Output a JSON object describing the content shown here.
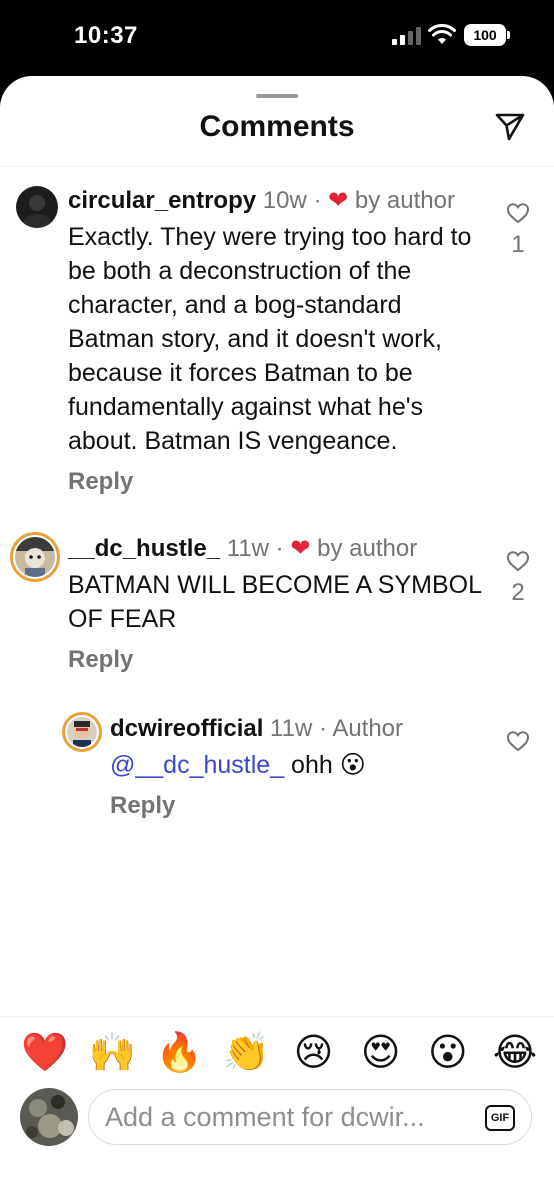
{
  "status_bar": {
    "time": "10:37",
    "battery": "100"
  },
  "header": {
    "title": "Comments",
    "send_icon": "send-icon"
  },
  "comments": [
    {
      "username": "circular_entropy",
      "time": "10w",
      "separator": "·",
      "heart": "❤",
      "liked_by": "by author",
      "text": "Exactly. They were trying too hard to be both a deconstruction of the character, and a bog-standard Batman story, and it doesn't work, because it forces Batman to be fundamentally against what he's about. Batman IS vengeance.",
      "reply_label": "Reply",
      "like_count": "1"
    },
    {
      "username": "__dc_hustle_",
      "time": "11w",
      "separator": "·",
      "heart": "❤",
      "liked_by": "by author",
      "text": "BATMAN WILL BECOME A SYMBOL OF FEAR",
      "reply_label": "Reply",
      "like_count": "2"
    }
  ],
  "reply": {
    "username": "dcwireofficial",
    "time": "11w",
    "separator": "·",
    "author_label": "Author",
    "mention": "@__dc_hustle_",
    "text": " ohh 😮",
    "reply_label": "Reply"
  },
  "reactions": [
    "❤️",
    "🙌",
    "🔥",
    "👏",
    "😢",
    "😍",
    "😮",
    "😂"
  ],
  "composer": {
    "placeholder": "Add a comment for dcwir...",
    "gif_label": "GIF"
  },
  "colors": {
    "accent_heart": "#e0233a",
    "mention": "#3b47c9",
    "secondary_text": "#737373"
  }
}
